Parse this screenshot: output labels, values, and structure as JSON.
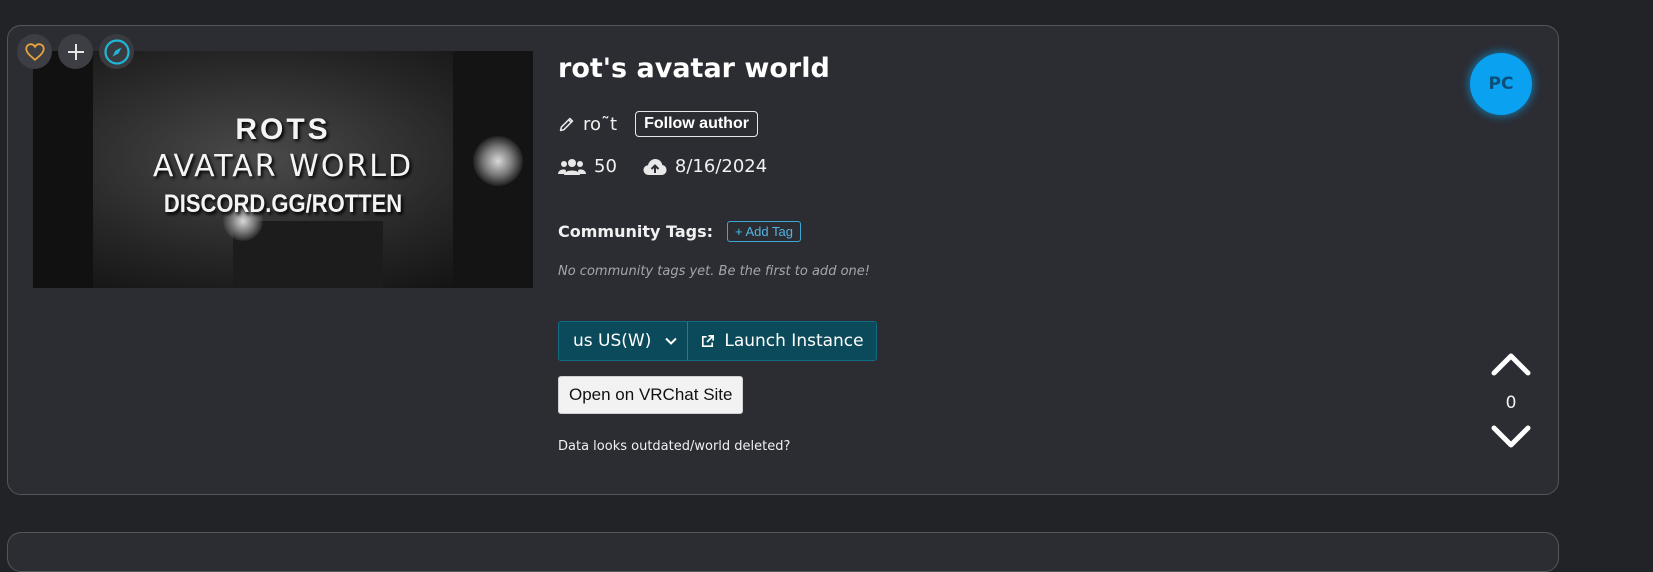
{
  "world": {
    "title": "rot's avatar world",
    "thumbnail": {
      "line1": "ROTS",
      "line2": "AVATAR WORLD",
      "line3": "DISCORD.GG/ROTTEN"
    },
    "author": "ro˜t",
    "follow_label": "Follow author",
    "players": "50",
    "updated": "8/16/2024"
  },
  "tags": {
    "label": "Community Tags:",
    "add_label": "+ Add Tag",
    "empty_text": "No community tags yet. Be the first to add one!"
  },
  "actions": {
    "region_selected": "us US(W)",
    "launch_label": "Launch Instance",
    "vrchat_label": "Open on VRChat Site",
    "outdated_text": "Data looks outdated/world deleted?"
  },
  "votes": {
    "count": "0"
  },
  "avatar": {
    "initials": "PC",
    "color": "#0aa1f0"
  },
  "icons": {
    "favorite": "heart-icon",
    "add": "plus-icon",
    "explore": "compass-icon",
    "author": "pencil-icon",
    "players": "users-icon",
    "updated": "cloud-upload-icon",
    "external": "external-link-icon",
    "upvote": "chevron-up-icon",
    "downvote": "chevron-down-icon"
  },
  "colors": {
    "background": "#222327",
    "card": "#2c2d33",
    "accent_teal": "#0b4a5a",
    "tag_blue": "#4fb6e4",
    "heart_orange": "#e6a23a",
    "compass_cyan": "#1eb7d8"
  }
}
